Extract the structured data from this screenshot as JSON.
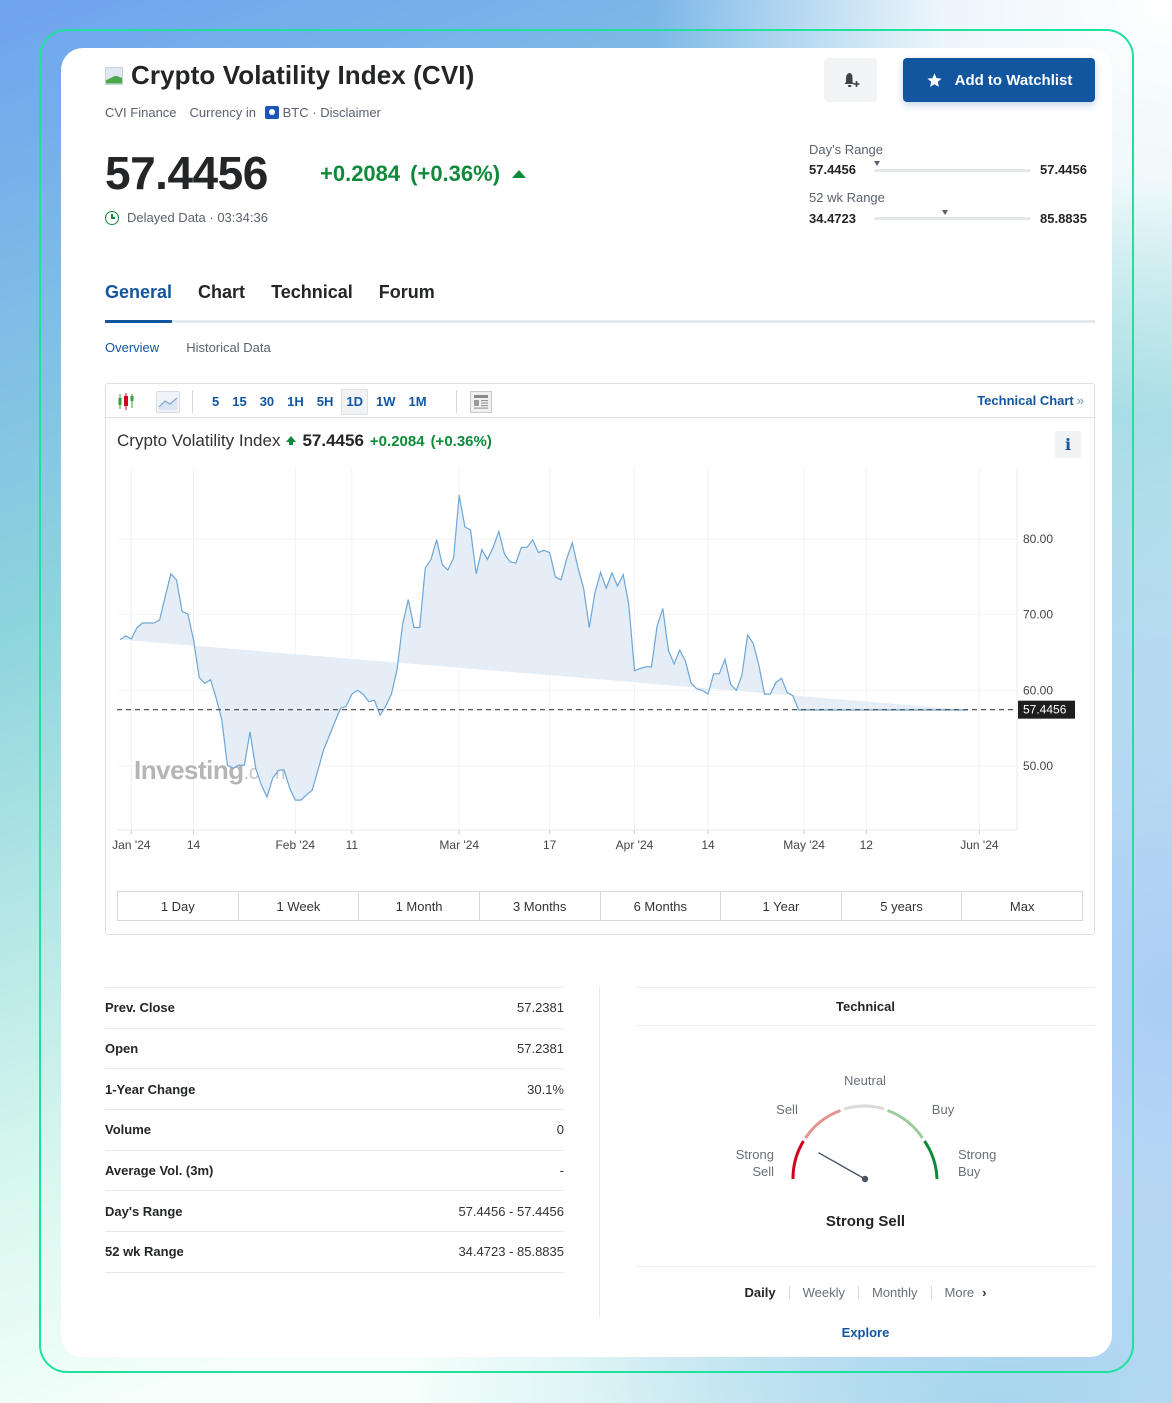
{
  "header": {
    "title": "Crypto Volatility Index (CVI)",
    "exchange": "CVI Finance",
    "currency_prefix": "Currency in",
    "currency": "BTC",
    "disclaimer": "· Disclaimer",
    "price": "57.4456",
    "change": "+0.2084",
    "change_pct": "(+0.36%)",
    "delayed": "Delayed Data · 03:34:36",
    "watchlist_button": "Add to Watchlist",
    "days_range": {
      "label": "Day's Range",
      "low": "57.4456",
      "high": "57.4456",
      "position": 0.0
    },
    "wk52_range": {
      "label": "52 wk Range",
      "low": "34.4723",
      "high": "85.8835",
      "position": 0.45
    }
  },
  "tabs": [
    {
      "label": "General",
      "active": true
    },
    {
      "label": "Chart",
      "active": false
    },
    {
      "label": "Technical",
      "active": false
    },
    {
      "label": "Forum",
      "active": false
    }
  ],
  "subtabs": [
    {
      "label": "Overview",
      "active": true
    },
    {
      "label": "Historical Data",
      "active": false
    }
  ],
  "toolbar": {
    "intervals": [
      {
        "label": "5",
        "active": false
      },
      {
        "label": "15",
        "active": false
      },
      {
        "label": "30",
        "active": false
      },
      {
        "label": "1H",
        "active": false
      },
      {
        "label": "5H",
        "active": false
      },
      {
        "label": "1D",
        "active": true
      },
      {
        "label": "1W",
        "active": false
      },
      {
        "label": "1M",
        "active": false
      }
    ],
    "technical_chart_link": "Technical Chart",
    "technical_chart_chevron": "»"
  },
  "chart_legend": {
    "name": "Crypto Volatility Index",
    "price": "57.4456",
    "change": "+0.2084",
    "change_pct": "(+0.36%)",
    "info": "i"
  },
  "chart_data": {
    "type": "area",
    "title": "Crypto Volatility Index",
    "watermark": "Investing",
    "watermark_suffix": ".com",
    "xlabel": "",
    "ylabel": "",
    "ylim": [
      41.5,
      89.5
    ],
    "yticks": [
      50,
      60,
      70,
      80
    ],
    "ytick_labels": [
      "50.00",
      "60.00",
      "70.00",
      "80.00"
    ],
    "x_day_range": [
      0,
      156
    ],
    "xticks": [
      {
        "day": 2,
        "label": "Jan '24"
      },
      {
        "day": 13,
        "label": "14"
      },
      {
        "day": 31,
        "label": "Feb '24"
      },
      {
        "day": 41,
        "label": "11"
      },
      {
        "day": 60,
        "label": "Mar '24"
      },
      {
        "day": 76,
        "label": "17"
      },
      {
        "day": 91,
        "label": "Apr '24"
      },
      {
        "day": 104,
        "label": "14"
      },
      {
        "day": 121,
        "label": "May '24"
      },
      {
        "day": 132,
        "label": "12"
      },
      {
        "day": 152,
        "label": "Jun '24"
      }
    ],
    "last_price": 57.4456,
    "last_price_label": "57.4456",
    "grid": true,
    "series": [
      {
        "name": "CVI",
        "x": [
          0,
          1,
          2,
          3,
          4,
          6,
          7,
          8,
          9,
          10,
          11,
          12,
          13,
          14,
          15,
          16,
          17,
          18,
          19,
          20,
          21,
          22,
          23,
          24,
          25,
          26,
          27,
          28,
          29,
          30,
          31,
          32,
          33,
          34,
          35,
          36,
          38,
          39,
          40,
          41,
          42,
          43,
          44,
          45,
          46,
          47,
          48,
          49,
          50,
          51,
          52,
          53,
          54,
          55,
          56,
          57,
          58,
          59,
          60,
          61,
          62,
          63,
          64,
          65,
          66,
          67,
          68,
          69,
          70,
          71,
          72,
          73,
          74,
          75,
          76,
          77,
          78,
          79,
          80,
          81,
          82,
          83,
          84,
          85,
          86,
          87,
          88,
          89,
          90,
          91,
          92,
          93,
          94,
          95,
          96,
          97,
          98,
          99,
          100,
          101,
          102,
          103,
          104,
          105,
          106,
          107,
          108,
          109,
          110,
          111,
          112,
          113,
          114,
          115,
          116,
          117,
          118,
          119,
          120,
          121,
          122,
          123,
          124,
          125,
          126,
          127,
          128,
          129,
          130,
          131,
          132,
          133,
          134,
          135,
          136,
          137,
          138,
          139,
          140,
          141,
          142,
          143,
          144,
          145,
          146,
          147,
          148,
          150,
          152,
          155
        ],
        "values": [
          66.7,
          67.2,
          66.8,
          68.3,
          68.9,
          68.9,
          69.3,
          72.4,
          75.4,
          74.6,
          70.4,
          70.1,
          66.7,
          61.7,
          60.9,
          61.4,
          59.0,
          56.1,
          50.1,
          49.7,
          50.1,
          50.1,
          54.5,
          49.7,
          47.5,
          45.9,
          48.4,
          49.4,
          49.5,
          47.1,
          45.5,
          45.5,
          46.2,
          46.8,
          49.4,
          52.1,
          55.8,
          57.6,
          57.9,
          59.5,
          60.0,
          59.5,
          58.5,
          58.7,
          56.7,
          57.9,
          59.5,
          62.7,
          68.8,
          72.0,
          68.3,
          68.3,
          76.2,
          77.3,
          79.9,
          76.6,
          75.9,
          77.5,
          85.8,
          81.6,
          81.2,
          75.4,
          78.6,
          77.3,
          78.9,
          81.0,
          78.0,
          77.0,
          76.8,
          78.9,
          78.9,
          79.9,
          78.2,
          78.5,
          78.2,
          75.0,
          74.6,
          77.4,
          79.5,
          76.2,
          73.5,
          68.3,
          72.9,
          75.6,
          73.5,
          75.5,
          73.8,
          75.3,
          71.3,
          62.6,
          62.9,
          63.1,
          63.1,
          68.5,
          70.8,
          65.3,
          63.5,
          65.3,
          63.9,
          61.0,
          60.2,
          60.0,
          59.5,
          62.2,
          62.2,
          64.1,
          60.8,
          60.0,
          62.0,
          67.3,
          66.2,
          63.3,
          59.5,
          59.5,
          61.0,
          61.6,
          59.7,
          59.3,
          57.4,
          57.4,
          57.4,
          57.4,
          57.4,
          57.4,
          57.4,
          57.4,
          57.4,
          57.4,
          57.4,
          57.4,
          57.4,
          57.4,
          57.4,
          57.4,
          57.4,
          57.4,
          57.4,
          57.4,
          57.4,
          57.4,
          57.4,
          57.4,
          57.4,
          57.4,
          57.4,
          57.4,
          57.4,
          57.4
        ]
      }
    ]
  },
  "period_buttons": [
    "1 Day",
    "1 Week",
    "1 Month",
    "3 Months",
    "6 Months",
    "1 Year",
    "5 years",
    "Max"
  ],
  "stats": [
    {
      "label": "Prev. Close",
      "value": "57.2381"
    },
    {
      "label": "Open",
      "value": "57.2381"
    },
    {
      "label": "1-Year Change",
      "value": "30.1%"
    },
    {
      "label": "Volume",
      "value": "0"
    },
    {
      "label": "Average Vol. (3m)",
      "value": "-"
    },
    {
      "label": "Day's Range",
      "value": "57.4456 - 57.4456"
    },
    {
      "label": "52 wk Range",
      "value": "34.4723 - 85.8835"
    }
  ],
  "technical": {
    "title": "Technical",
    "gauge_labels": {
      "strong_sell": [
        "Strong",
        "Sell"
      ],
      "sell": "Sell",
      "neutral": "Neutral",
      "buy": "Buy",
      "strong_buy": [
        "Strong",
        "Buy"
      ]
    },
    "gauge_value": 0.08,
    "result": "Strong Sell",
    "timeframes": [
      {
        "label": "Daily",
        "active": true
      },
      {
        "label": "Weekly",
        "active": false
      },
      {
        "label": "Monthly",
        "active": false
      },
      {
        "label": "More",
        "active": false
      }
    ],
    "more_chevron": "›",
    "explore": "Explore"
  },
  "colors": {
    "brand": "#1256a0",
    "positive": "#0f8a3a",
    "negative": "#d0021b",
    "line": "#6ea6d6",
    "area": "#e6edf5",
    "frame": "#1de29b"
  }
}
